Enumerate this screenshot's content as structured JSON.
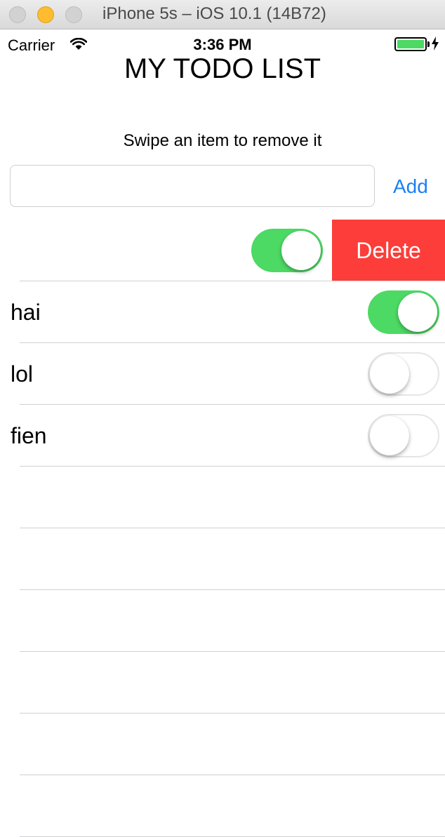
{
  "window": {
    "title": "iPhone 5s – iOS 10.1 (14B72)",
    "buttons": [
      "close",
      "minimize",
      "zoom"
    ]
  },
  "status_bar": {
    "carrier": "Carrier",
    "time": "3:36 PM",
    "wifi_icon": "wifi-icon",
    "battery_icon": "battery-icon",
    "charging_icon": "bolt-icon",
    "battery_color": "#4cd964"
  },
  "app": {
    "title": "MY TODO LIST",
    "instructions": "Swipe an item to remove it",
    "input": {
      "value": "",
      "placeholder": ""
    },
    "add_label": "Add",
    "delete_label": "Delete"
  },
  "todos": [
    {
      "label": "",
      "done": true,
      "swiped": true
    },
    {
      "label": "hai",
      "done": true
    },
    {
      "label": "lol",
      "done": false
    },
    {
      "label": "fien",
      "done": false
    }
  ],
  "empty_row_count": 6,
  "colors": {
    "accent": "#1a80f5",
    "switch_on": "#4cd964",
    "delete": "#fc3d39"
  }
}
